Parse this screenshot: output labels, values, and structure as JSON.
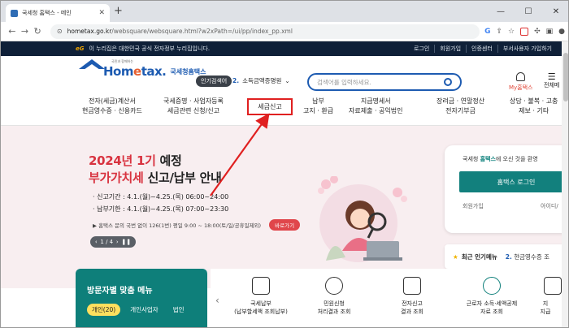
{
  "browser": {
    "tab_title": "국세청 홈택스 - 메인",
    "tab_close": "✕",
    "new_tab": "+",
    "window_controls": [
      "—",
      "☐",
      "✕"
    ],
    "url_host": "hometax.go.kr",
    "url_path": "/websquare/websquare.html?w2xPath=/ui/pp/index_pp.xml"
  },
  "topbar": {
    "logo_text": "eG",
    "notice": "이 누리집은 대한민국 공식 전자정부 누리집입니다.",
    "links": [
      "로그인",
      "회원가입",
      "인증센터",
      "부서사용자 가입하기"
    ]
  },
  "header": {
    "logo_tiny": "국민과 함께하는",
    "logo_word_a": "Hom",
    "logo_word_b": "e",
    "logo_word_c": "tax.",
    "logo_sub": "국세청홈택스",
    "popular_badge": "인기검색어",
    "popular_rank": "2.",
    "popular_term": "소득금액증명원",
    "search_placeholder": "검색어를 입력하세요.",
    "my_hometax": "My홈택스",
    "all_menu": "전체메"
  },
  "gnb": [
    {
      "line1": "전자(세금)계산서",
      "line2": "현금영수증 · 신용카드"
    },
    {
      "line1": "국세증명 · 사업자등록",
      "line2": "세금관련 신청/신고"
    },
    {
      "line1": "세금신고",
      "line2": ""
    },
    {
      "line1": "납부",
      "line2": "고지 · 환급"
    },
    {
      "line1": "지급명세서",
      "line2": "자료제출 · 공익법인"
    },
    {
      "line1": "장려금 · 연말정산",
      "line2": "전자기부금"
    },
    {
      "line1": "상담 · 불복 · 고충",
      "line2": "제보 · 기타"
    }
  ],
  "hero": {
    "title_a": "2024년 1기",
    "title_b": "예정",
    "subtitle_a": "부가가치세",
    "subtitle_b": "신고/납부 안내",
    "line1": "· 신고기간 : 4.1.(월)~4.25.(목) 06:00~24:00",
    "line2": "· 납부기한 : 4.1.(월)~4.25.(목) 07:00~23:30",
    "note": "▶ 홈택스 문의 국번 없이 126(1번) 평일 9:00 ~ 18:00(토/일/공휴일제외)",
    "note_button": "바로가기",
    "pager": "1 / 4",
    "pager_prev": "‹",
    "pager_next": "›",
    "pager_pause": "❚❚"
  },
  "login": {
    "title_a": "국세청",
    "title_b": "홈택스",
    "title_c": "에 오신 것을 환영",
    "button": "홈택스 로그인",
    "link1": "회원가입",
    "link2": "아이디/"
  },
  "recent": {
    "label": "최근 인기메뉴",
    "rank": "2.",
    "item": "현금영수증 조"
  },
  "visitor": {
    "title": "방문자별 맞춤 메뉴",
    "tabs": [
      "개인(20)",
      "개인사업자",
      "법인"
    ]
  },
  "quick": {
    "prev": "‹",
    "items": [
      {
        "line1": "국세납부",
        "line2": "(납부할세액 조회납부)"
      },
      {
        "line1": "민원신청",
        "line2": "처리결과 조회"
      },
      {
        "line1": "전자신고",
        "line2": "결과 조회"
      },
      {
        "line1": "근로자 소득·세액공제",
        "line2": "자료 조회"
      },
      {
        "line1": "지",
        "line2": "지급"
      }
    ]
  },
  "colors": {
    "accent": "#0e7f7a",
    "brand_blue": "#1d5bb1",
    "highlight_red": "#e02020",
    "hero_bg": "#f8eef0",
    "topbar_bg": "#0f2038"
  }
}
